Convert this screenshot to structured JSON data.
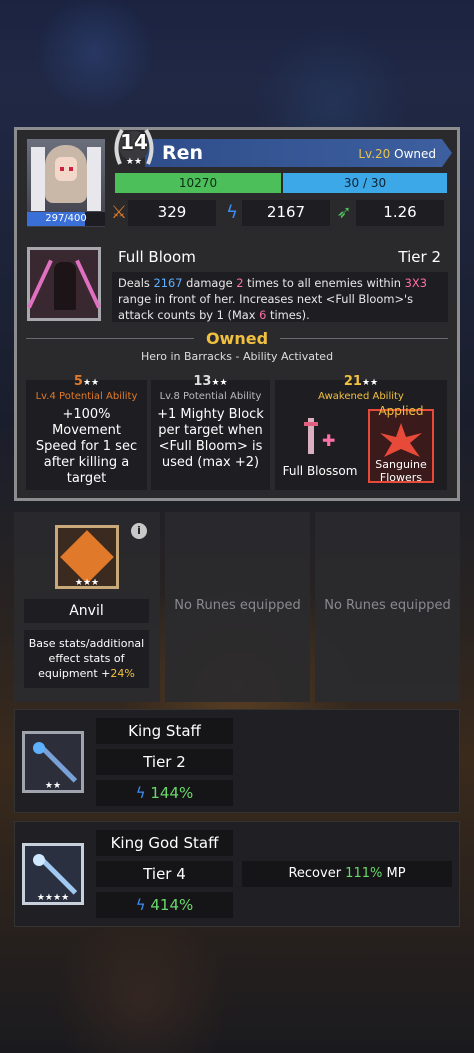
{
  "hero": {
    "name": "Ren",
    "level_prefix": "Lv.20",
    "owned_label": "Owned",
    "rank": "14",
    "rank_stars": "★★",
    "hp_text": "297/400",
    "hp_fraction": 0.74,
    "xp_text": "10270",
    "mp_text": "30 / 30",
    "attack": "329",
    "magic": "2167",
    "speed": "1.26"
  },
  "skill": {
    "name": "Full Bloom",
    "tier": "Tier 2",
    "desc_1a": "Deals ",
    "desc_dmg": "2167",
    "desc_1b": " damage ",
    "desc_times": "2",
    "desc_1c": " times to all enemies within ",
    "desc_range": "3X3",
    "desc_1d": " range in front of her. Increases next <Full Bloom>'s attack counts by 1 (Max ",
    "desc_max": "6",
    "desc_1e": " times)."
  },
  "owned": {
    "title": "Owned",
    "subtitle": "Hero in Barracks - Ability Activated"
  },
  "potentials": [
    {
      "level": "5",
      "stars": "★★",
      "label": "Lv.4 Potential Ability",
      "text": "+100% Movement Speed for 1 sec after killing a target"
    },
    {
      "level": "13",
      "stars": "★★",
      "label": "Lv.8 Potential Ability",
      "text": "+1 Mighty Block per target when <Full Bloom> is used (max +2)"
    },
    {
      "level": "21",
      "stars": "★★",
      "label": "Awakened Ability",
      "opt1": "Full Blossom",
      "applied": "Applied",
      "opt2": "Sanguine Flowers"
    }
  ],
  "runes": {
    "anvil_name": "Anvil",
    "anvil_stars": "★★★",
    "anvil_desc_a": "Base stats/additional effect stats of equipment +",
    "anvil_pct": "24%",
    "info": "i",
    "empty1": "No Runes equipped",
    "empty2": "No Runes equipped"
  },
  "weapons": [
    {
      "name": "King Staff",
      "tier": "Tier 2",
      "pct": "144%",
      "stars": "★★"
    },
    {
      "name": "King God Staff",
      "tier": "Tier 4",
      "pct": "414%",
      "stars": "★★★★",
      "recover_a": "Recover ",
      "recover_pct": "111%",
      "recover_b": " MP"
    }
  ],
  "colors": {
    "accent_gold": "#f0c040",
    "magic_blue": "#5fb0ff",
    "attack_orange": "#e07a2a",
    "speed_green": "#4cbf5a"
  }
}
